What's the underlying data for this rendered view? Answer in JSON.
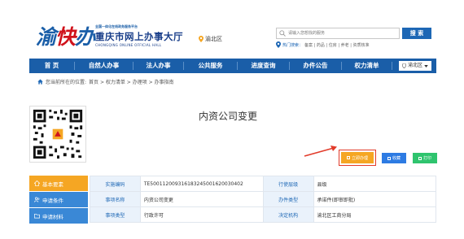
{
  "header": {
    "logo_mark_a": "渝",
    "logo_mark_b": "快",
    "logo_mark_c": "办",
    "logo_small": "全国一体化在线政务服务平台",
    "logo_title": "重庆市网上办事大厅",
    "logo_en": "CHONGQING ONLINE OFFICIAL HALL",
    "region": "渝北区",
    "search_placeholder": "请输入您想找的服务",
    "search_button": "搜 索",
    "hot_label": "热门搜索：",
    "hot_items": "备案 | 药品 | 住房 | 养老 | 资质核准"
  },
  "nav": {
    "items": [
      "首 页",
      "自然人办事",
      "法人办事",
      "公共服务",
      "进度查询",
      "办件公告",
      "权力清单"
    ],
    "region": "渝北区"
  },
  "breadcrumb": {
    "prefix": "您当前所在的位置:",
    "path": "首页 > 权力清单 > 办理项 > 办事指南"
  },
  "main": {
    "title": "内资公司变更",
    "apply_label": "立即办理",
    "fav_label": "收藏",
    "print_label": "打印"
  },
  "side": {
    "items": [
      "基本要素",
      "申请条件",
      "申请材料"
    ]
  },
  "table": {
    "rows": [
      [
        "实施编码",
        "TE500112009316183245001620030402",
        "行使层级",
        "县级"
      ],
      [
        "事项名称",
        "内资公司变更",
        "办件类型",
        "承诺件(即审即批)"
      ],
      [
        "事项类型",
        "行政许可",
        "决定机构",
        "渝北区工商分局"
      ]
    ]
  },
  "colors": {
    "brand_blue": "#1a5ea8",
    "apply_orange": "#f5a623",
    "fav_blue": "#2d7be3",
    "print_green": "#2fc46e",
    "arrow_red": "#e23b2a"
  }
}
